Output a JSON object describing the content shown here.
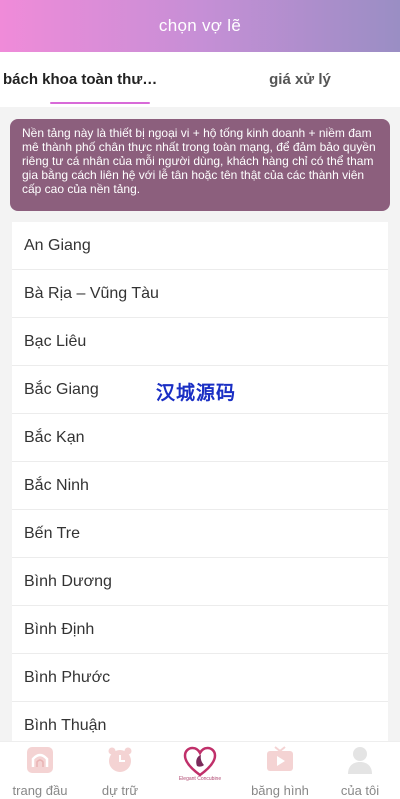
{
  "header": {
    "title": "chọn vợ lẽ"
  },
  "tabs": [
    {
      "label": "bách khoa toàn thư…",
      "active": true
    },
    {
      "label": "giá xử lý",
      "active": false
    }
  ],
  "notice": {
    "text": "Nền tảng này là thiết bị ngoại vi + hộ tống kinh doanh + niềm đam mê thành phố chân thực nhất trong toàn mạng, để đảm bảo quyền riêng tư cá nhân của mỗi người dùng, khách hàng chỉ có thể tham gia bằng cách liên hệ với lễ tân hoặc tên thật của các thành viên cấp cao của nền tảng."
  },
  "provinces": [
    "An Giang",
    "Bà Rịa – Vũng Tàu",
    "Bạc Liêu",
    "Bắc Giang",
    "Bắc Kạn",
    "Bắc Ninh",
    "Bến Tre",
    "Bình Dương",
    "Bình Định",
    "Bình Phước",
    "Bình Thuận"
  ],
  "watermark": "汉城源码",
  "tabbar": {
    "items": [
      {
        "label": "trang đầu",
        "icon": "home-icon"
      },
      {
        "label": "dự trữ",
        "icon": "alarm-clock-icon"
      },
      {
        "label": "",
        "icon": "heart-logo-icon",
        "logo_text": "Elegant Concubine"
      },
      {
        "label": "băng hình",
        "icon": "video-icon"
      },
      {
        "label": "của tôi",
        "icon": "user-icon"
      }
    ]
  },
  "colors": {
    "header_gradient_start": "#f08bd9",
    "header_gradient_end": "#9a8ec4",
    "notice_bg": "#8c5f7d",
    "tab_indicator": "#d86ad8",
    "watermark": "#1a2fc4"
  }
}
